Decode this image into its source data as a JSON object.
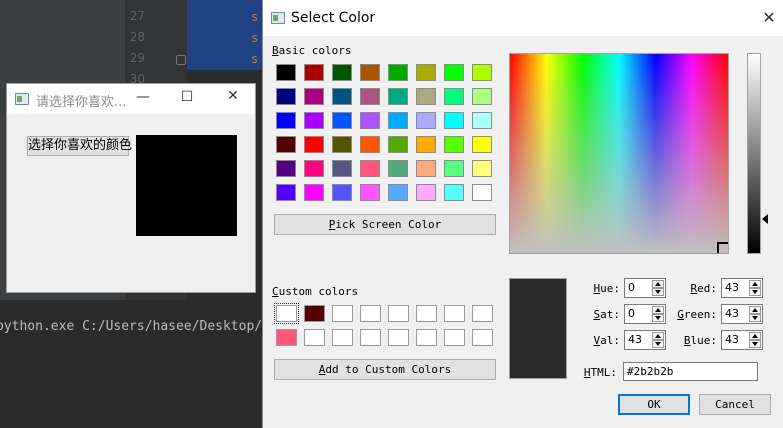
{
  "ide": {
    "line_numbers": [
      "27",
      "28",
      "29",
      "30"
    ],
    "code_chars": [
      "s",
      "s",
      "s"
    ],
    "terminal_text": "python.exe C:/Users/hasee/Desktop/"
  },
  "small_window": {
    "title": "请选择你喜欢...",
    "button_label": "选择你喜欢的颜色",
    "preview_color": "#000000"
  },
  "dialog": {
    "title": "Select Color",
    "basic_colors_label": "Basic colors",
    "basic_colors": [
      [
        "#000000",
        "#aa0000",
        "#005500",
        "#aa5500",
        "#00aa00",
        "#aaaa00",
        "#00ff00",
        "#aaff00"
      ],
      [
        "#00007f",
        "#aa007f",
        "#00557f",
        "#aa557f",
        "#00aa7f",
        "#aaaa7f",
        "#00ff7f",
        "#aaff7f"
      ],
      [
        "#0000ff",
        "#aa00ff",
        "#0055ff",
        "#aa55ff",
        "#00aaff",
        "#aaaaff",
        "#00ffff",
        "#aaffff"
      ],
      [
        "#550000",
        "#ff0000",
        "#555500",
        "#ff5500",
        "#55aa00",
        "#ffaa00",
        "#55ff00",
        "#ffff00"
      ],
      [
        "#55007f",
        "#ff007f",
        "#55557f",
        "#ff557f",
        "#55aa7f",
        "#ffaa7f",
        "#55ff7f",
        "#ffff7f"
      ],
      [
        "#5500ff",
        "#ff00ff",
        "#5555ff",
        "#ff55ff",
        "#55aaff",
        "#ffaaff",
        "#55ffff",
        "#ffffff"
      ]
    ],
    "pick_screen_label": "Pick Screen Color",
    "custom_colors_label": "Custom colors",
    "custom_colors": [
      [
        "#ffffff",
        "#550000",
        "#ffffff",
        "#ffffff",
        "#ffffff",
        "#ffffff",
        "#ffffff",
        "#ffffff"
      ],
      [
        "#ff557f",
        "#ffffff",
        "#ffffff",
        "#ffffff",
        "#ffffff",
        "#ffffff",
        "#ffffff",
        "#ffffff"
      ]
    ],
    "add_custom_label": "Add to Custom Colors",
    "preview_color": "#2b2b2b",
    "fields": {
      "hue_label": "Hue:",
      "hue": "0",
      "sat_label": "Sat:",
      "sat": "0",
      "val_label": "Val:",
      "val": "43",
      "red_label": "Red:",
      "red": "43",
      "green_label": "Green:",
      "green": "43",
      "blue_label": "Blue:",
      "blue": "43",
      "html_label": "HTML:",
      "html": "#2b2b2b"
    },
    "ok_label": "OK",
    "cancel_label": "Cancel"
  }
}
